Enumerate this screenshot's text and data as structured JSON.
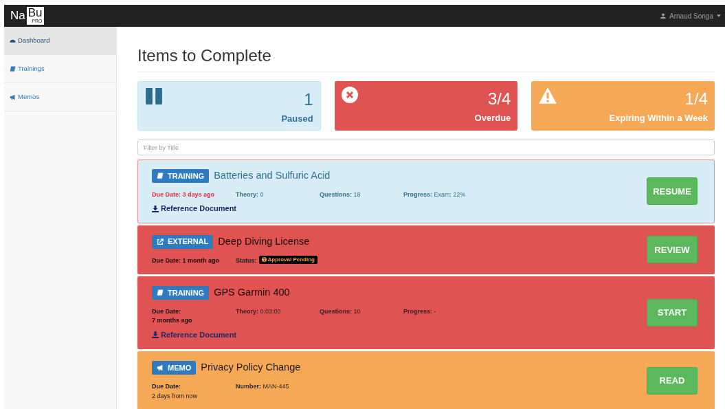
{
  "navbar": {
    "logo": [
      "Na",
      "Bu",
      "PRO"
    ],
    "user": "Arnaud Songa"
  },
  "sidebar": {
    "items": [
      {
        "label": "Dashboard",
        "selected": true
      },
      {
        "label": "Trainings",
        "selected": false
      },
      {
        "label": "Memos",
        "selected": false
      }
    ]
  },
  "title": "Items to Complete",
  "summary": [
    {
      "kind": "paused",
      "count": "1",
      "label": "Paused"
    },
    {
      "kind": "overdue",
      "count": "3/4",
      "label": "Overdue"
    },
    {
      "kind": "expiring",
      "count": "1/4",
      "label": "Expiring Within a Week"
    }
  ],
  "filter": {
    "placeholder": "Filter by Title"
  },
  "items": [
    {
      "kind": "paused",
      "highlighted": true,
      "badge": {
        "kind": "training",
        "label": "TRAINING"
      },
      "title": "Batteries and Sulfuric Acid",
      "due_label": "Due Date:",
      "due": "3 days ago",
      "due_line_break": false,
      "fields": [
        {
          "label": "Theory:",
          "value": "0"
        },
        {
          "label": "Questions:",
          "value": "18"
        },
        {
          "label": "Progress:",
          "value": "Exam: 22%"
        }
      ],
      "link": "Reference Document",
      "button": "RESUME"
    },
    {
      "kind": "overdue",
      "highlighted": false,
      "badge": {
        "kind": "external",
        "label": "EXTERNAL"
      },
      "title": "Deep Diving License",
      "due_label": "Due Date:",
      "due": "1 month ago",
      "due_line_break": false,
      "status_label": "Status:",
      "status_badge": "Approval Pending",
      "button": "REVIEW"
    },
    {
      "kind": "overdue",
      "highlighted": false,
      "badge": {
        "kind": "training",
        "label": "TRAINING"
      },
      "title": "GPS Garmin 400",
      "due_label": "Due Date:",
      "due": "7 months ago",
      "due_line_break": true,
      "fields": [
        {
          "label": "Theory:",
          "value": "0:03:00"
        },
        {
          "label": "Questions:",
          "value": "10"
        },
        {
          "label": "Progress:",
          "value": "-"
        }
      ],
      "link": "Reference Document",
      "button": "START"
    },
    {
      "kind": "expiring",
      "highlighted": false,
      "badge": {
        "kind": "memo",
        "label": "MEMO"
      },
      "title": "Privacy Policy Change",
      "due_label": "Due Date:",
      "due": "2 days from now",
      "due_line_break": true,
      "fields": [
        {
          "label": "Number:",
          "value": "MAN-445"
        }
      ],
      "button": "READ"
    }
  ]
}
